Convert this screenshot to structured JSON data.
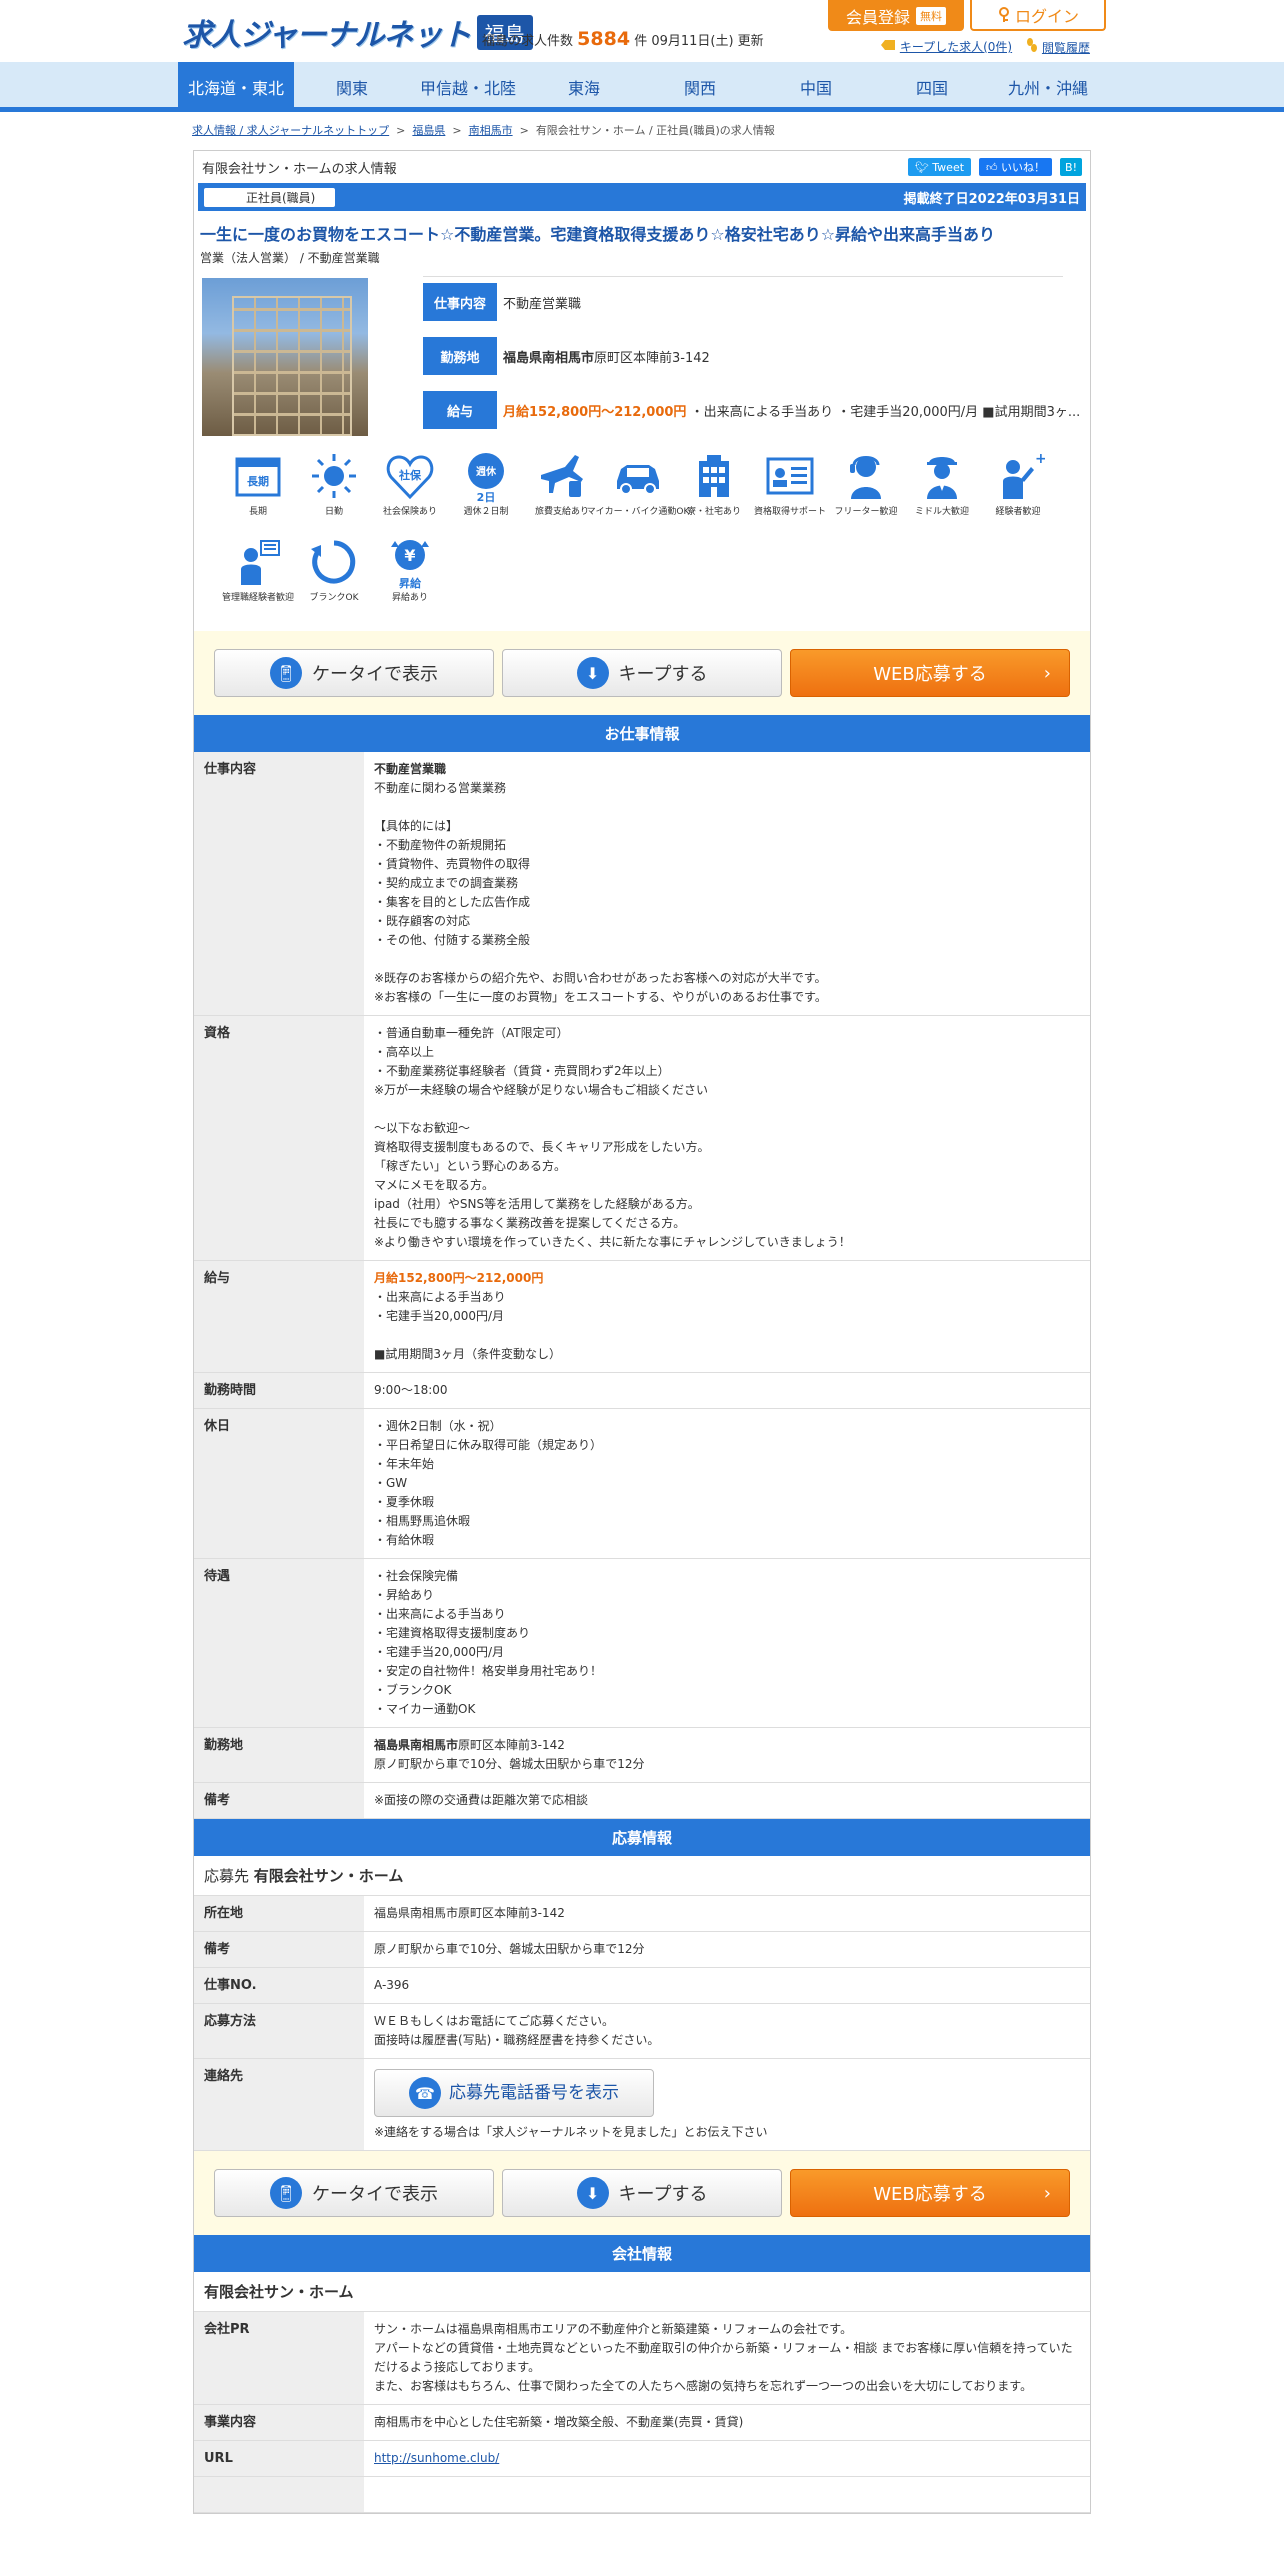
{
  "header": {
    "logo_text": "求人ジャーナルネット",
    "logo_pref": "福島",
    "count_prefix": "福島の求人件数",
    "count_num": "5884",
    "count_suffix": "件 09月11日(土) 更新",
    "register": "会員登録",
    "free": "無料",
    "login": "ログイン",
    "kept": "キープした求人(0件)",
    "history": "閲覧履歴"
  },
  "nav": [
    "北海道・東北",
    "関東",
    "甲信越・北陸",
    "東海",
    "関西",
    "中国",
    "四国",
    "九州・沖縄"
  ],
  "breadcrumb": {
    "items": [
      "求人情報 / 求人ジャーナルネットトップ",
      "福島県",
      "南相馬市"
    ],
    "current": "有限会社サン・ホーム / 正社員(職員)の求人情報",
    "sep": ">"
  },
  "card": {
    "company_head": "有限会社サン・ホームの求人情報",
    "tweet": "Tweet",
    "like": "いいね！",
    "hb": "B!",
    "employment_type": "正社員(職員)",
    "end_date": "掲載終了日2022年03月31日",
    "title": "一生に一度のお買物をエスコート☆不動産営業。宅建資格取得支援あり☆格安社宅あり☆昇給や出来高手当あり",
    "category": "営業（法人営業） / 不動産営業職",
    "summary": {
      "job_label": "仕事内容",
      "job_value": "不動産営業職",
      "loc_label": "勤務地",
      "loc_bold": "福島県南相馬市",
      "loc_rest": "原町区本陣前3-142",
      "pay_label": "給与",
      "pay_bold": "月給152,800円～212,000円",
      "pay_rest": " ・出来高による手当あり ・宅建手当20,000円/月 ■試用期間3ヶ..."
    }
  },
  "icons": [
    {
      "name": "long-term-icon",
      "label": "長期",
      "color": "#2878d8"
    },
    {
      "name": "daytime-icon",
      "label": "日勤",
      "color": "#2878d8"
    },
    {
      "name": "insurance-icon",
      "label": "社会保険あり",
      "color": "#2878d8"
    },
    {
      "name": "two-days-off-icon",
      "label": "週休２日制",
      "color": "#2878d8"
    },
    {
      "name": "travel-icon",
      "label": "旅費支給あり",
      "color": "#2878d8"
    },
    {
      "name": "car-icon",
      "label": "マイカー・バイク通勤OK",
      "color": "#2878d8"
    },
    {
      "name": "housing-icon",
      "label": "寮・社宅あり",
      "color": "#2878d8"
    },
    {
      "name": "qualification-icon",
      "label": "資格取得サポート",
      "color": "#2878d8"
    },
    {
      "name": "freeter-icon",
      "label": "フリーター歓迎",
      "color": "#2878d8"
    },
    {
      "name": "middle-icon",
      "label": "ミドル大歓迎",
      "color": "#2878d8"
    },
    {
      "name": "experienced-icon",
      "label": "経験者歓迎",
      "color": "#2878d8"
    },
    {
      "name": "mgmt-experienced-icon",
      "label": "管理職経験者歓迎",
      "color": "#2878d8"
    },
    {
      "name": "blank-ok-icon",
      "label": "ブランクOK",
      "color": "#2878d8"
    },
    {
      "name": "raise-icon",
      "label": "昇給あり",
      "color": "#2878d8"
    }
  ],
  "actions": {
    "mobile": "ケータイで表示",
    "keep": "キープする",
    "web": "WEB応募する"
  },
  "job_info": {
    "heading": "お仕事情報",
    "rows": [
      {
        "th": "仕事内容",
        "lead": "不動産営業職",
        "text": "不動産に関わる営業業務\n\n【具体的には】\n・不動産物件の新規開拓\n・賃貸物件、売買物件の取得\n・契約成立までの調査業務\n・集客を目的とした広告作成\n・既存顧客の対応\n・その他、付随する業務全般\n\n※既存のお客様からの紹介先や、お問い合わせがあったお客様への対応が大半です。\n※お客様の「一生に一度のお買物」をエスコートする、やりがいのあるお仕事です。"
      },
      {
        "th": "資格",
        "lead": "",
        "text": "・普通自動車一種免許（AT限定可）\n・高卒以上\n・不動産業務従事経験者（賃貸・売買問わず2年以上）\n※万が一未経験の場合や経験が足りない場合もご相談ください\n\n～以下なお歓迎～\n資格取得支援制度もあるので、長くキャリア形成をしたい方。\n「稼ぎたい」という野心のある方。\nマメにメモを取る方。\nipad（社用）やSNS等を活用して業務をした経験がある方。\n社長にでも臆する事なく業務改善を提案してくださる方。\n※より働きやすい環境を作っていきたく、共に新たな事にチャレンジしていきましょう！"
      },
      {
        "th": "給与",
        "lead_orange": "月給152,800円～212,000円",
        "text": "・出来高による手当あり\n・宅建手当20,000円/月\n\n■試用期間3ヶ月（条件変動なし）"
      },
      {
        "th": "勤務時間",
        "lead": "",
        "text": "9:00～18:00"
      },
      {
        "th": "休日",
        "lead": "",
        "text": "・週休2日制（水・祝）\n・平日希望日に休み取得可能（規定あり）\n・年末年始\n・GW\n・夏季休暇\n・相馬野馬追休暇\n・有給休暇"
      },
      {
        "th": "待遇",
        "lead": "",
        "text": "・社会保険完備\n・昇給あり\n・出来高による手当あり\n・宅建資格取得支援制度あり\n・宅建手当20,000円/月\n・安定の自社物件！格安単身用社宅あり！\n・ブランクOK\n・マイカー通勤OK"
      },
      {
        "th": "勤務地",
        "lead_bold": "福島県南相馬市",
        "lead_rest": "原町区本陣前3-142",
        "text": "原ノ町駅から車で10分、磐城太田駅から車で12分"
      },
      {
        "th": "備考",
        "lead": "",
        "text": "※面接の際の交通費は距離次第で応相談"
      }
    ]
  },
  "apply_info": {
    "heading": "応募情報",
    "label": "応募先",
    "company": "有限会社サン・ホーム",
    "rows": [
      {
        "th": "所在地",
        "text": "福島県南相馬市原町区本陣前3-142"
      },
      {
        "th": "備考",
        "text": "原ノ町駅から車で10分、磐城太田駅から車で12分"
      },
      {
        "th": "仕事NO.",
        "text": "A-396"
      },
      {
        "th": "応募方法",
        "text": "ＷＥＢもしくはお電話にてご応募ください。\n面接時は履歴書(写貼)・職務経歴書を持参ください。"
      }
    ],
    "contact_th": "連絡先",
    "tel_button": "応募先電話番号を表示",
    "contact_note": "※連絡をする場合は「求人ジャーナルネットを見ました」とお伝え下さい"
  },
  "company_info": {
    "heading": "会社情報",
    "name": "有限会社サン・ホーム",
    "rows": [
      {
        "th": "会社PR",
        "text": "サン・ホームは福島県南相馬市エリアの不動産仲介と新築建築・リフォームの会社です。\nアパートなどの賃貸借・土地売買などといった不動産取引の仲介から新築・リフォーム・相談 までお客様に厚い信頼を持っていただけるよう接応しております。\nまた、お客様はもちろん、仕事で関わった全ての人たちへ感謝の気持ちを忘れず一つ一つの出会いを大切にしております。"
      },
      {
        "th": "事業内容",
        "text": "南相馬市を中心とした住宅新築・増改築全般、不動産業(売買・賃貸)"
      },
      {
        "th": "URL",
        "link": "http://sunhome.club/"
      }
    ]
  }
}
